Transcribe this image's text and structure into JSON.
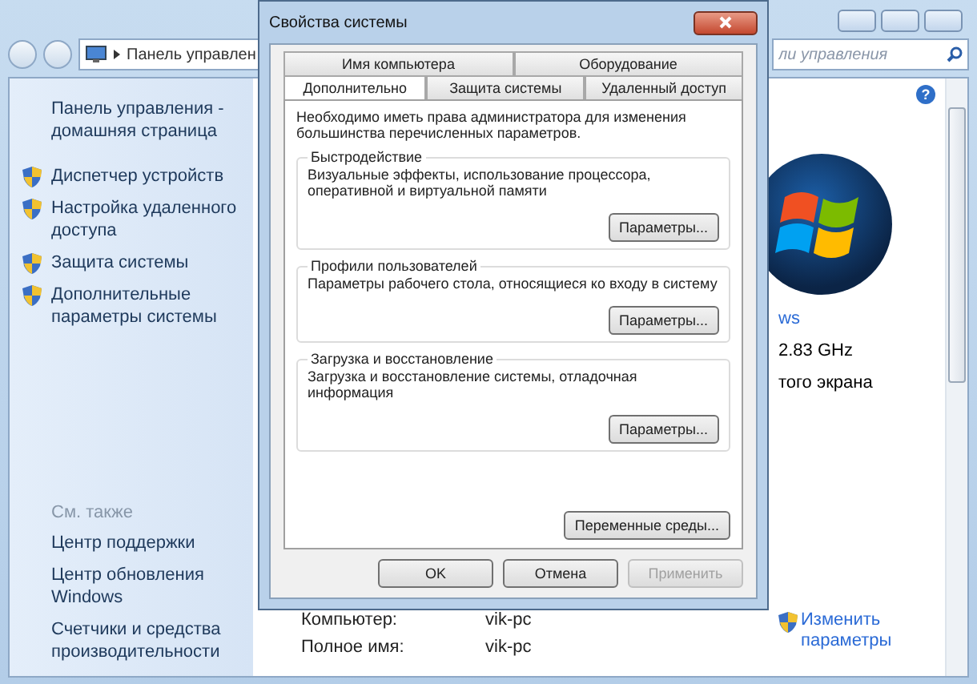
{
  "window": {
    "address": "Панель управлен",
    "search_placeholder": "ли управления"
  },
  "sidebar": {
    "items": [
      {
        "label": "Панель управления - домашняя страница",
        "kind": "link"
      },
      {
        "label": "Диспетчер устройств",
        "kind": "shield"
      },
      {
        "label": "Настройка удаленного доступа",
        "kind": "shield"
      },
      {
        "label": "Защита системы",
        "kind": "shield"
      },
      {
        "label": "Дополнительные параметры системы",
        "kind": "shield"
      }
    ],
    "see_also_heading": "См. также",
    "see_also": [
      "Центр поддержки",
      "Центр обновления Windows",
      "Счетчики и средства производительности"
    ]
  },
  "main": {
    "help_glyph": "?",
    "info": [
      {
        "text": "ws",
        "kind": "link"
      },
      {
        "text": "2.83 GHz",
        "kind": "plain"
      },
      {
        "text": "того экрана",
        "kind": "plain"
      }
    ],
    "details": [
      {
        "label": "Компьютер:",
        "value": "vik-pc"
      },
      {
        "label": "Полное имя:",
        "value": "vik-pc"
      }
    ],
    "change_link": "Изменить параметры"
  },
  "dialog": {
    "title": "Свойства системы",
    "tab_rows": [
      [
        {
          "label": "Имя компьютера",
          "selected": false
        },
        {
          "label": "Оборудование",
          "selected": false
        }
      ],
      [
        {
          "label": "Дополнительно",
          "selected": true
        },
        {
          "label": "Защита системы",
          "selected": false
        },
        {
          "label": "Удаленный доступ",
          "selected": false
        }
      ]
    ],
    "note": "Необходимо иметь права администратора для изменения большинства перечисленных параметров.",
    "groups": [
      {
        "title": "Быстродействие",
        "text": "Визуальные эффекты, использование процессора, оперативной и виртуальной памяти",
        "button": "Параметры..."
      },
      {
        "title": "Профили пользователей",
        "text": "Параметры рабочего стола, относящиеся ко входу в систему",
        "button": "Параметры..."
      },
      {
        "title": "Загрузка и восстановление",
        "text": "Загрузка и восстановление системы, отладочная информация",
        "button": "Параметры..."
      }
    ],
    "env_button": "Переменные среды...",
    "buttons": [
      {
        "label": "OK",
        "disabled": false
      },
      {
        "label": "Отмена",
        "disabled": false
      },
      {
        "label": "Применить",
        "disabled": true
      }
    ]
  }
}
